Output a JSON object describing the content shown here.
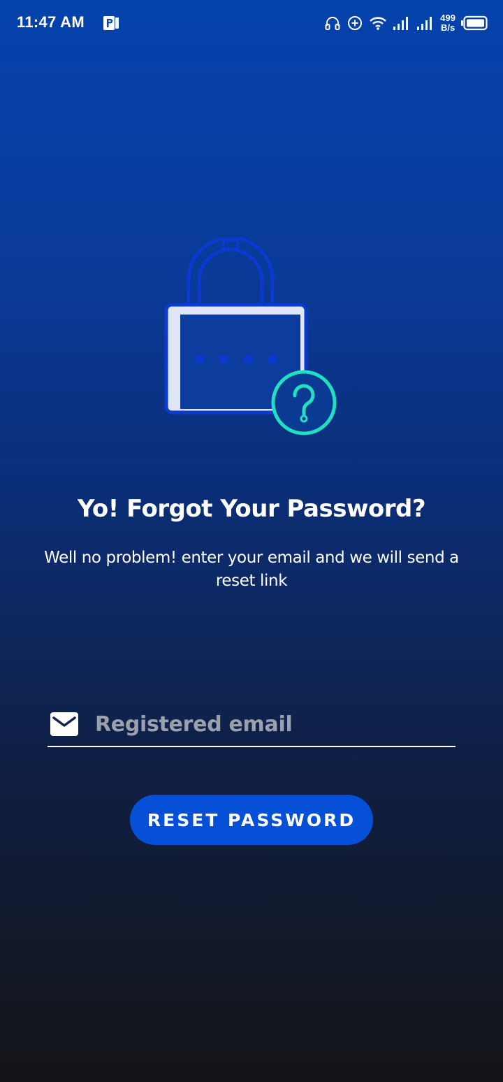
{
  "status_bar": {
    "time": "11:47 AM",
    "net_speed_value": "499",
    "net_speed_unit": "B/s",
    "icons": [
      "app-p-icon",
      "headset-icon",
      "data-saver-icon",
      "wifi-icon",
      "signal-icon",
      "signal-icon",
      "battery-icon"
    ]
  },
  "illustration": {
    "name": "lock-question-illustration",
    "colors": {
      "lock_outline": "#0a3ad0",
      "lock_fill": "#dfe6f5",
      "question_circle": "#1fe0c0"
    }
  },
  "content": {
    "title": "Yo! Forgot Your Password?",
    "subtitle": "Well no problem! enter your email and we will send a reset link"
  },
  "form": {
    "email_icon": "mail-icon",
    "email_value": "",
    "email_placeholder": "Registered email",
    "submit_label": "RESET PASSWORD"
  },
  "colors": {
    "gradient_top": "#0442ad",
    "gradient_bottom": "#131416",
    "button_bg": "#0650d8",
    "placeholder": "#9aa1ad",
    "text": "#ffffff"
  }
}
